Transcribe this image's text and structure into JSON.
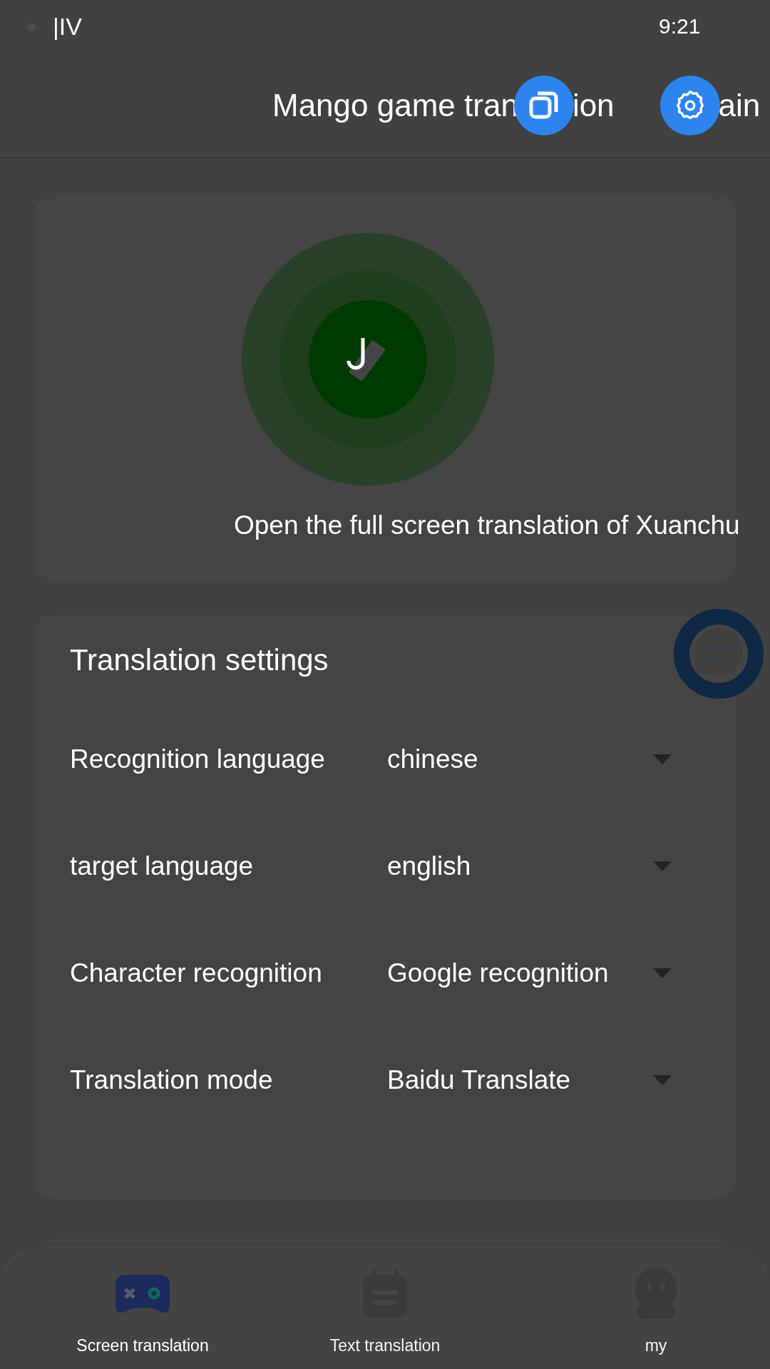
{
  "status_bar": {
    "left": "|IV",
    "time": "9:21"
  },
  "header": {
    "title_start": "Mango game tran",
    "title_end": "ion",
    "trailing": "ain"
  },
  "hero": {
    "caption": "Open the full screen translation of Xuanchu"
  },
  "settings": {
    "title": "Translation settings",
    "rows": [
      {
        "label": "Recognition language",
        "value": "chinese"
      },
      {
        "label": "target language",
        "value": "english"
      },
      {
        "label": "Character recognition",
        "value": "Google recognition"
      },
      {
        "label": "Translation mode",
        "value": "Baidu Translate"
      }
    ]
  },
  "nav": [
    {
      "kind": "gamepad",
      "label": "Screen translation",
      "selected": true
    },
    {
      "kind": "notepad",
      "label": "Text translation",
      "selected": false
    },
    {
      "kind": "person",
      "label": "my",
      "selected": false
    }
  ]
}
